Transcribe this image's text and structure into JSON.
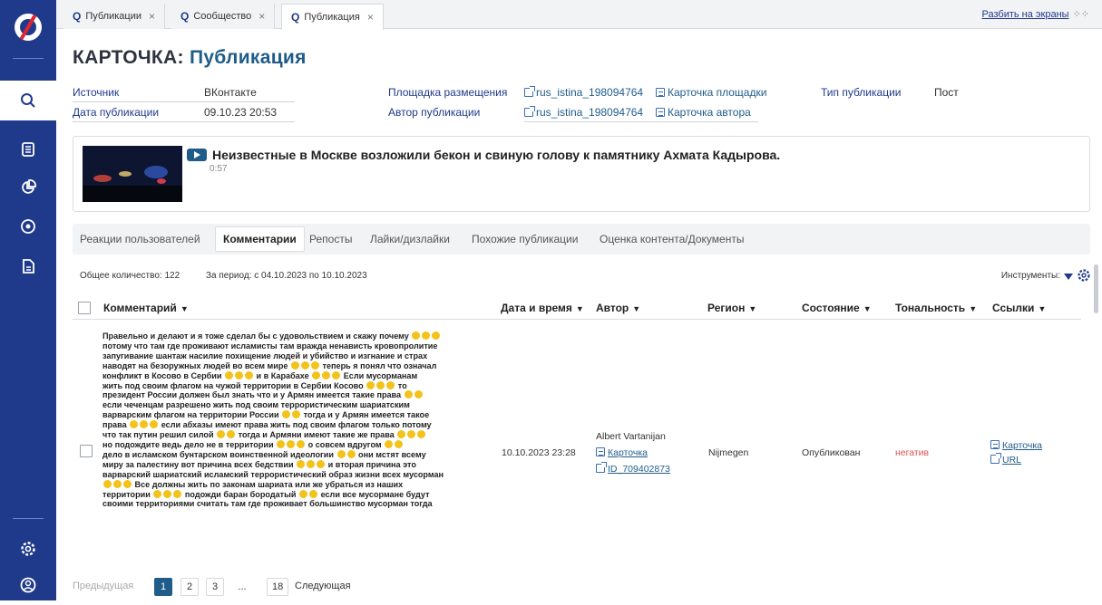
{
  "tabs": [
    {
      "label": "Публикации"
    },
    {
      "label": "Сообщество"
    },
    {
      "label": "Публикация"
    }
  ],
  "split_label": "Разбить на экраны",
  "header": {
    "title_prefix": "КАРТОЧКА:",
    "title_value": "Публикация"
  },
  "meta": {
    "source_label": "Источник",
    "source_value": "ВКонтакте",
    "date_label": "Дата публикации",
    "date_value": "09.10.23 20:53",
    "platform_label": "Площадка размещения",
    "platform_link": "rus_istina_198094764",
    "platform_card": "Карточка площадки",
    "author_label": "Автор публикации",
    "author_link": "rus_istina_198094764",
    "author_card": "Карточка автора",
    "type_label": "Тип публикации",
    "type_value": "Пост"
  },
  "video": {
    "title": "Неизвестные в Москве возложили бекон и свиную голову к памятнику Ахмата Кадырова.",
    "duration": "0:57"
  },
  "section_tabs": [
    "Реакции пользователей",
    "Комментарии",
    "Репосты",
    "Лайки/дизлайки",
    "Похожие публикации",
    "Оценка контента/Документы"
  ],
  "table": {
    "total": "Общее количество: 122",
    "period": "За период: с 04.10.2023 по 10.10.2023",
    "tools": "Инструменты:",
    "columns": [
      "Комментарий",
      "Дата и время",
      "Автор",
      "Регион",
      "Состояние",
      "Тональность",
      "Ссылки"
    ],
    "row": {
      "comment_lines": [
        "Правельно и делают и я тоже сделал бы с удовольствием и скажу почему",
        "потому что там где проживают исламисты там вражда ненависть кровопролитие",
        "запугивание шантаж насилие похищение людей и убийство и изгнание и страх",
        "наводят на безоружных людей во всем мире",
        "теперь я понял что означал",
        "конфликт в Косово в Сербии",
        "и в Карабахе",
        "Если мусорманам",
        "жить под своим флагом на чужой территории в Сербии Косово",
        "то",
        "президент России должен был знать что и у Армян имеется такие права",
        "если чеченцам разрешено жить под своим террористическим шариатским",
        "варварским флагом на территории России",
        "тогда и у Армян имеется такое",
        "права",
        "если абхазы имеют права жить под своим флагом только потому",
        "что так путин решил силой",
        "тогда и Армяни имеют такие же права",
        "но подождите ведь дело не в территории",
        "о совсем вдругом",
        "дело в исламском бунтарском воинственной идеологии",
        "они мстят всему",
        "миру за палестину вот причина всех бедствии",
        "и вторая причина это",
        "варварский шариатский исламский террористический образ жизни всех мусорман",
        "Все должны жить по законам шариата или же убраться из наших",
        "территории",
        "подожди баран бородатый",
        "если все мусормане будут",
        "своими территориями считать там где проживает большинство мусорман тогда"
      ],
      "datetime": "10.10.2023 23:28",
      "author_name": "Albert Vartanijan",
      "author_card": "Карточка",
      "author_id": "ID_709402873",
      "region": "Nijmegen",
      "state": "Опубликован",
      "tone": "негатив",
      "link_card": "Карточка",
      "link_url": "URL"
    }
  },
  "pager": {
    "prev": "Предыдущая",
    "pages": [
      "1",
      "2",
      "3",
      "...",
      "18"
    ],
    "next": "Следующая"
  },
  "colors": {
    "rail": "#1f3a8a",
    "accent": "#1f5c8a",
    "negative": "#e05252"
  }
}
